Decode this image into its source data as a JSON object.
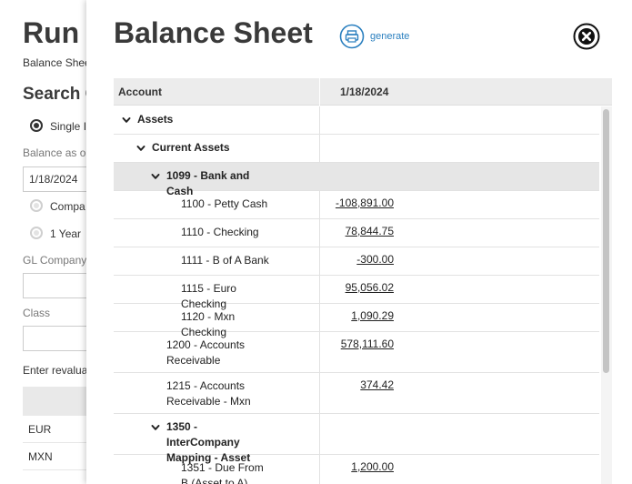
{
  "background": {
    "title": "Run",
    "subtitle": "Balance Shee",
    "section": "Search C",
    "radio_single": "Single I",
    "balance_as_of_label": "Balance as o",
    "balance_as_of_value": "1/18/2024",
    "radio_company": "Compa",
    "radio_year": "1 Year",
    "gl_company_label": "GL Company",
    "class_label": "Class",
    "revalue_label": "Enter revalua",
    "currency_rows": [
      "EUR",
      "MXN"
    ]
  },
  "modal": {
    "title": "Balance Sheet",
    "generate_label": "generate",
    "icons": {
      "generate": "print-icon",
      "close": "close-icon",
      "expand": "chevron-down-icon"
    },
    "accent_color": "#2a7fbf",
    "columns": {
      "account": "Account",
      "date": "1/18/2024"
    },
    "rows": [
      {
        "label": "Assets",
        "value": "",
        "level": 0,
        "bold": true,
        "caret": true,
        "highlight": false,
        "lines": 1
      },
      {
        "label": "Current Assets",
        "value": "",
        "level": 1,
        "bold": true,
        "caret": true,
        "highlight": false,
        "lines": 1
      },
      {
        "label": "1099 - Bank and Cash",
        "value": "",
        "level": 2,
        "bold": true,
        "caret": true,
        "highlight": true,
        "lines": 1
      },
      {
        "label": "1100 - Petty Cash",
        "value": "-108,891.00",
        "level": 3,
        "bold": false,
        "caret": false,
        "highlight": false,
        "lines": 1
      },
      {
        "label": "1110 - Checking",
        "value": "78,844.75",
        "level": 3,
        "bold": false,
        "caret": false,
        "highlight": false,
        "lines": 1
      },
      {
        "label": "1111 - B of A Bank",
        "value": "-300.00",
        "level": 3,
        "bold": false,
        "caret": false,
        "highlight": false,
        "lines": 1
      },
      {
        "label": "1115 - Euro Checking",
        "value": "95,056.02",
        "level": 3,
        "bold": false,
        "caret": false,
        "highlight": false,
        "lines": 1
      },
      {
        "label": "1120 - Mxn Checking",
        "value": "1,090.29",
        "level": 3,
        "bold": false,
        "caret": false,
        "highlight": false,
        "lines": 1
      },
      {
        "label": "1200 - Accounts Receivable",
        "value": "578,111.60",
        "level": 2,
        "bold": false,
        "caret": false,
        "highlight": false,
        "lines": 2
      },
      {
        "label": "1215 - Accounts Receivable - Mxn",
        "value": "374.42",
        "level": 2,
        "bold": false,
        "caret": false,
        "highlight": false,
        "lines": 2
      },
      {
        "label": "1350 - InterCompany Mapping - Asset",
        "value": "",
        "level": 2,
        "bold": true,
        "caret": true,
        "highlight": false,
        "lines": 2
      },
      {
        "label": "1351 - Due From B (Asset to A)",
        "value": "1,200.00",
        "level": 3,
        "bold": false,
        "caret": false,
        "highlight": false,
        "lines": 2
      }
    ]
  }
}
